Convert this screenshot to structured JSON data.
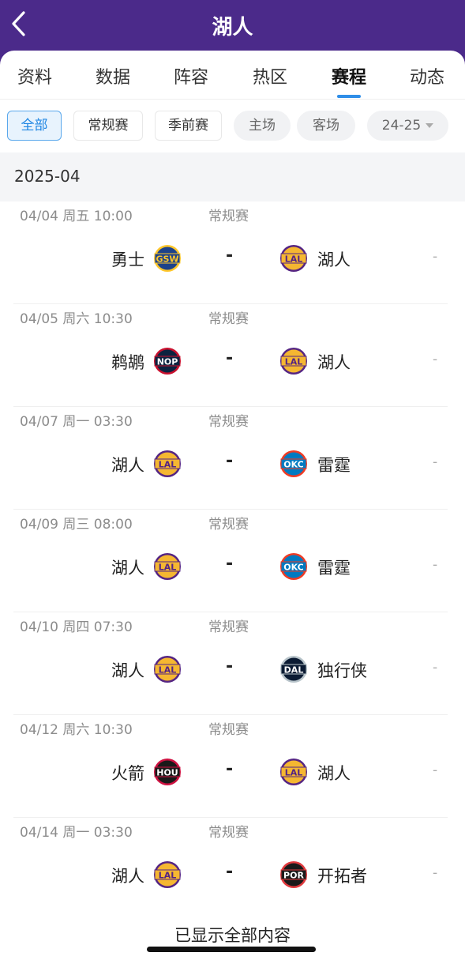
{
  "header": {
    "title": "湖人"
  },
  "tabs": [
    {
      "label": "资料"
    },
    {
      "label": "数据"
    },
    {
      "label": "阵容"
    },
    {
      "label": "热区"
    },
    {
      "label": "赛程",
      "active": true
    },
    {
      "label": "动态"
    }
  ],
  "filters": {
    "all": "全部",
    "regular": "常规赛",
    "preseason": "季前赛",
    "home": "主场",
    "away": "客场",
    "season": "24-25"
  },
  "month": "2025-04",
  "games": [
    {
      "time": "04/04  周五 10:00",
      "stage": "常规赛",
      "home": "勇士",
      "home_code": "GSW",
      "away": "湖人",
      "away_code": "LAL",
      "vs": "-",
      "result": "-"
    },
    {
      "time": "04/05  周六 10:30",
      "stage": "常规赛",
      "home": "鹈鹕",
      "home_code": "NOP",
      "away": "湖人",
      "away_code": "LAL",
      "vs": "-",
      "result": "-"
    },
    {
      "time": "04/07  周一 03:30",
      "stage": "常规赛",
      "home": "湖人",
      "home_code": "LAL",
      "away": "雷霆",
      "away_code": "OKC",
      "vs": "-",
      "result": "-"
    },
    {
      "time": "04/09  周三 08:00",
      "stage": "常规赛",
      "home": "湖人",
      "home_code": "LAL",
      "away": "雷霆",
      "away_code": "OKC",
      "vs": "-",
      "result": "-"
    },
    {
      "time": "04/10  周四 07:30",
      "stage": "常规赛",
      "home": "湖人",
      "home_code": "LAL",
      "away": "独行侠",
      "away_code": "DAL",
      "vs": "-",
      "result": "-"
    },
    {
      "time": "04/12  周六 10:30",
      "stage": "常规赛",
      "home": "火箭",
      "home_code": "HOU",
      "away": "湖人",
      "away_code": "LAL",
      "vs": "-",
      "result": "-"
    },
    {
      "time": "04/14  周一 03:30",
      "stage": "常规赛",
      "home": "湖人",
      "home_code": "LAL",
      "away": "开拓者",
      "away_code": "POR",
      "vs": "-",
      "result": "-"
    }
  ],
  "footer": "已显示全部内容",
  "colors": {
    "header": "#4b2a8a",
    "accent": "#2f8ee8",
    "team_colors": {
      "LAL": {
        "bg": "#f5b731",
        "ring": "#552583",
        "text": "#552583"
      },
      "GSW": {
        "bg": "#1d428a",
        "ring": "#ffc72c",
        "text": "#ffc72c"
      },
      "NOP": {
        "bg": "#0c2340",
        "ring": "#c8102e",
        "text": "#ffffff"
      },
      "OKC": {
        "bg": "#007ac1",
        "ring": "#ef3b24",
        "text": "#ffffff"
      },
      "DAL": {
        "bg": "#0b1b33",
        "ring": "#b8c4ca",
        "text": "#ffffff"
      },
      "HOU": {
        "bg": "#1a1a1a",
        "ring": "#ce1141",
        "text": "#ffffff"
      },
      "POR": {
        "bg": "#1a1a1a",
        "ring": "#e03a3e",
        "text": "#ffffff"
      }
    }
  }
}
